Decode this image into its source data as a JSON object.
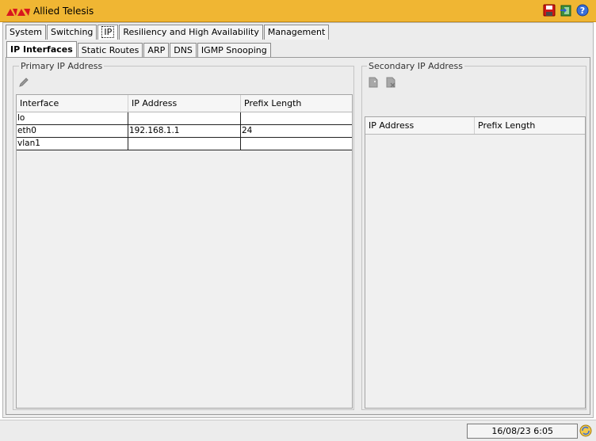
{
  "app": {
    "title": "Allied Telesis"
  },
  "main_tabs": [
    {
      "label": "System"
    },
    {
      "label": "Switching"
    },
    {
      "label": "IP"
    },
    {
      "label": "Resiliency and High Availability"
    },
    {
      "label": "Management"
    }
  ],
  "sub_tabs": [
    {
      "label": "IP Interfaces"
    },
    {
      "label": "Static Routes"
    },
    {
      "label": "ARP"
    },
    {
      "label": "DNS"
    },
    {
      "label": "IGMP Snooping"
    }
  ],
  "primary": {
    "title": "Primary IP Address",
    "columns": [
      "Interface",
      "IP Address",
      "Prefix Length"
    ],
    "rows": [
      {
        "interface": "lo",
        "ip": "",
        "prefix": ""
      },
      {
        "interface": "eth0",
        "ip": "192.168.1.1",
        "prefix": "24"
      },
      {
        "interface": "vlan1",
        "ip": "",
        "prefix": ""
      }
    ]
  },
  "secondary": {
    "title": "Secondary IP Address",
    "columns": [
      "IP Address",
      "Prefix Length"
    ]
  },
  "status": {
    "datetime": "16/08/23 6:05"
  },
  "icons": {
    "logo": "allied-telesis-logo",
    "save": "save-icon",
    "exit": "exit-icon",
    "help": "help-icon",
    "edit": "pencil-icon",
    "add": "add-icon",
    "delete": "delete-icon",
    "sync": "sync-icon"
  },
  "colors": {
    "titlebar": "#f0b633",
    "logo_red": "#d8171e"
  }
}
